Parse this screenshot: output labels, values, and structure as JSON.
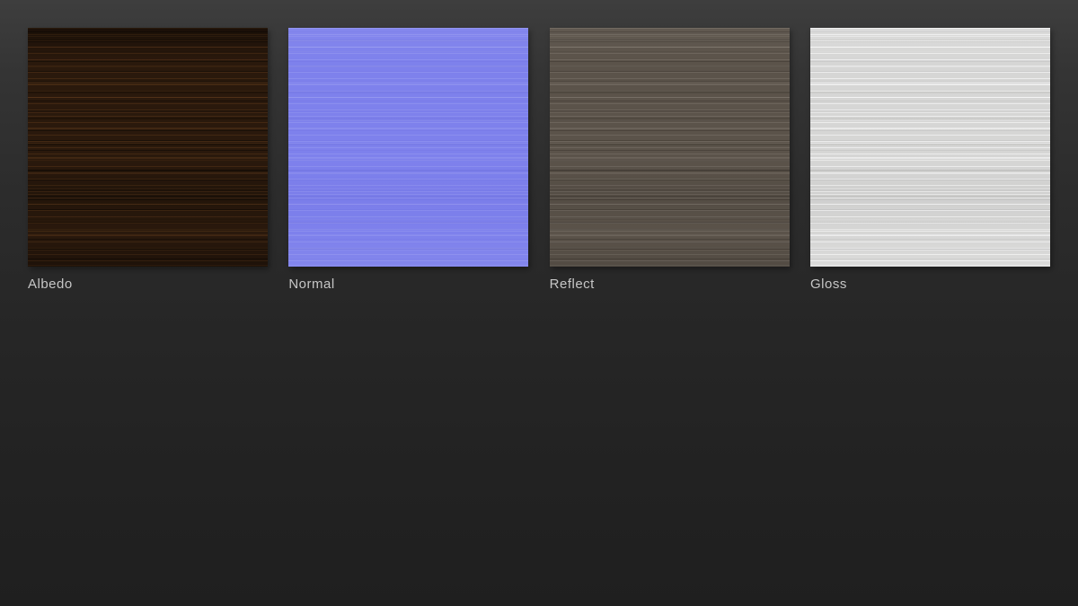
{
  "page": {
    "background_top_color": "#3e3e3e",
    "background_bottom_color": "#1f1f1f",
    "label_color": "#c6c6c6"
  },
  "textures": [
    {
      "label": "Albedo",
      "base_color": "#2a190c",
      "appearance": "dark brown wood grain, horizontal streaks"
    },
    {
      "label": "Normal",
      "base_color": "#7e81ec",
      "appearance": "lavender-blue normal map, faint horizontal streaks"
    },
    {
      "label": "Reflect",
      "base_color": "#5b534a",
      "appearance": "taupe gray-brown, horizontal brushed streaks"
    },
    {
      "label": "Gloss",
      "base_color": "#d6d6d5",
      "appearance": "light gray, faint horizontal brushed streaks"
    }
  ]
}
